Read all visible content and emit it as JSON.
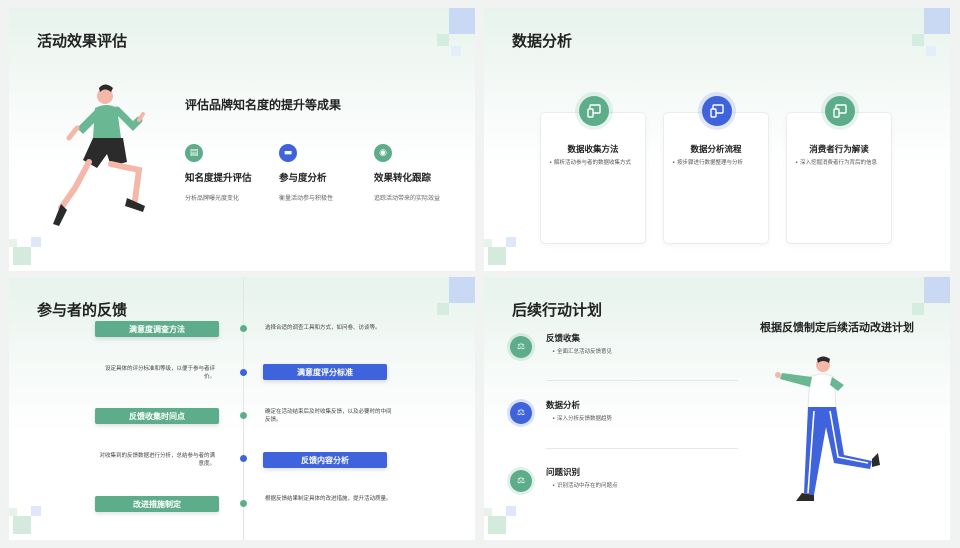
{
  "colors": {
    "green": "#5dad8a",
    "blue": "#3e63dd",
    "light_green": "#e7f3ec"
  },
  "slide1": {
    "title": "活动效果评估",
    "heading": "评估品牌知名度的提升等成果",
    "features": [
      {
        "icon": "message-icon",
        "title": "知名度提升评估",
        "desc": "分析品牌曝光度变化"
      },
      {
        "icon": "chat-icon",
        "title": "参与度分析",
        "desc": "衡量活动参与积极性"
      },
      {
        "icon": "target-icon",
        "title": "效果转化跟踪",
        "desc": "追踪活动带来的实际效益"
      }
    ]
  },
  "slide2": {
    "title": "数据分析",
    "cards": [
      {
        "icon": "devices-icon",
        "title": "数据收集方法",
        "desc": "解析活动参与者的数据收集方式"
      },
      {
        "icon": "devices-icon",
        "title": "数据分析流程",
        "desc": "按步骤进行数据整理与分析"
      },
      {
        "icon": "devices-icon",
        "title": "消费者行为解读",
        "desc": "深入挖掘消费者行为背后的信息"
      }
    ]
  },
  "slide3": {
    "title": "参与者的反馈",
    "items": [
      {
        "label": "满意度调查方法",
        "text": "选择合适的调查工具和方式，如问卷、访谈等。"
      },
      {
        "label": "满意度评分标准",
        "text": "设定具体的评分标准和等级，以便于参与者评价。"
      },
      {
        "label": "反馈收集时间点",
        "text": "确定在活动结束后及时收集反馈，以及必要时的中间反馈。"
      },
      {
        "label": "反馈内容分析",
        "text": "对收集到的反馈数据进行分析，总结参与者的满意度。"
      },
      {
        "label": "改进措施制定",
        "text": "根据反馈结果制定具体的改进措施，提升活动质量。"
      }
    ]
  },
  "slide4": {
    "title": "后续行动计划",
    "heading": "根据反馈制定后续活动改进计划",
    "items": [
      {
        "icon": "scale-icon",
        "title": "反馈收集",
        "desc": "全面汇总活动反馈意见"
      },
      {
        "icon": "scale-icon",
        "title": "数据分析",
        "desc": "深入分析反馈数据趋势"
      },
      {
        "icon": "scale-icon",
        "title": "问题识别",
        "desc": "识别活动中存在的问题点"
      }
    ]
  }
}
